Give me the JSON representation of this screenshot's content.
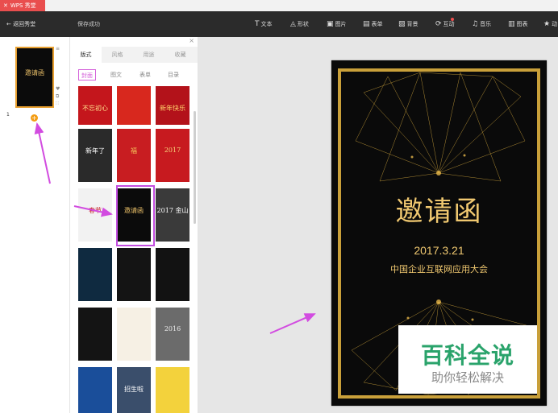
{
  "titlebar": {
    "app_name": "WPS 秀堂"
  },
  "toolbar": {
    "back_label": "← 返回秀堂",
    "save_status": "保存成功",
    "tools": [
      {
        "label": "文本",
        "icon": "text-icon",
        "glyph": "T"
      },
      {
        "label": "形状",
        "icon": "shape-icon",
        "glyph": "◬"
      },
      {
        "label": "图片",
        "icon": "image-icon",
        "glyph": "▣"
      },
      {
        "label": "表单",
        "icon": "form-icon",
        "glyph": "▤"
      },
      {
        "label": "背景",
        "icon": "background-icon",
        "glyph": "▨"
      },
      {
        "label": "互动",
        "icon": "interaction-icon",
        "glyph": "⟳"
      },
      {
        "label": "音乐",
        "icon": "music-icon",
        "glyph": "♫"
      },
      {
        "label": "图表",
        "icon": "chart-icon",
        "glyph": "▥"
      },
      {
        "label": "动",
        "icon": "animation-icon",
        "glyph": "★"
      }
    ]
  },
  "pages": {
    "current_number": "1",
    "thumb_title": "邀请函"
  },
  "panel": {
    "tabs": [
      "版式",
      "风格",
      "用途",
      "收藏"
    ],
    "subtabs": [
      "封面",
      "图文",
      "表单",
      "目录"
    ]
  },
  "templates": [
    {
      "label": "不忘初心",
      "bg": "#c4161c",
      "fg": "#ffe08a"
    },
    {
      "label": "",
      "bg": "#d8281e",
      "fg": "#ffd36b"
    },
    {
      "label": "新年快乐",
      "bg": "#b3121a",
      "fg": "#ffd36b"
    },
    {
      "label": "新年了",
      "bg": "#2a2a2a",
      "fg": "#ffffff"
    },
    {
      "label": "福",
      "bg": "#c81d21",
      "fg": "#f3c25a"
    },
    {
      "label": "2017",
      "bg": "#c71a1f",
      "fg": "#f6d37a"
    },
    {
      "label": "春节",
      "bg": "#f2f2f2",
      "fg": "#c62026"
    },
    {
      "label": "邀请函",
      "bg": "#0b0b0b",
      "fg": "#f2c66b"
    },
    {
      "label": "2017 金山",
      "bg": "#3a3a3a",
      "fg": "#ffffff"
    },
    {
      "label": "",
      "bg": "#0f2a40",
      "fg": "#d0b46a"
    },
    {
      "label": "",
      "bg": "#141414",
      "fg": "#e0b14a"
    },
    {
      "label": "",
      "bg": "#121212",
      "fg": "#c9a03a"
    },
    {
      "label": "",
      "bg": "#141414",
      "fg": "#e0b14a"
    },
    {
      "label": "",
      "bg": "#f6f0e4",
      "fg": "#c62026"
    },
    {
      "label": "2016",
      "bg": "#6b6b6b",
      "fg": "#eaeaea"
    },
    {
      "label": "",
      "bg": "#1a4e9a",
      "fg": "#ffffff"
    },
    {
      "label": "招生啦",
      "bg": "#3a4e6b",
      "fg": "#ffffff"
    },
    {
      "label": "",
      "bg": "#f3d23c",
      "fg": "#c62026"
    }
  ],
  "canvas": {
    "title": "邀请函",
    "date": "2017.3.21",
    "subtitle": "中国企业互联网应用大会"
  },
  "watermark": {
    "main": "百科全说",
    "sub": "助你轻松解决"
  }
}
